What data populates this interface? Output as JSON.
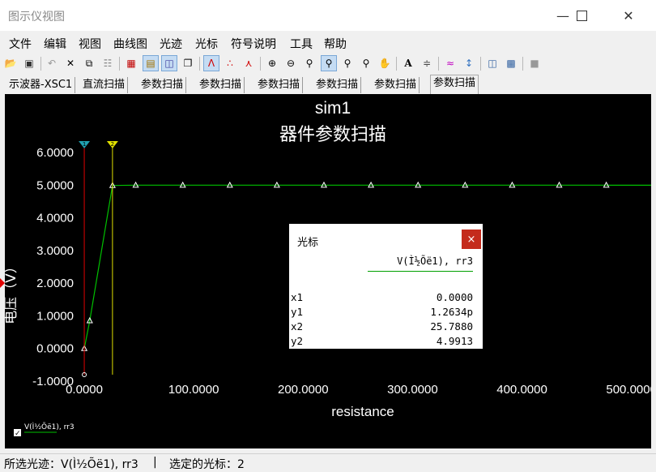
{
  "window": {
    "title": "图示仪视图",
    "minimize_icon": "minimize-icon",
    "maximize_icon": "maximize-icon",
    "close_icon": "close-icon"
  },
  "menu": [
    "文件",
    "编辑",
    "视图",
    "曲线图",
    "光迹",
    "光标",
    "符号说明",
    "工具",
    "帮助"
  ],
  "tabs": [
    "示波器-XSC1",
    "直流扫描",
    "参数扫描",
    "参数扫描",
    "参数扫描",
    "参数扫描",
    "参数扫描",
    "参数扫描"
  ],
  "active_tab_index": 7,
  "graph": {
    "title": "sim1",
    "subtitle": "器件参数扫描",
    "background": "#000000",
    "trace_color": "#00c000",
    "cursor1_color": "#e00000",
    "cursor2_color": "#e0e000",
    "cursor1_label": "1",
    "cursor2_label": "2",
    "legend_label": "V(Ì½Õë1), rr3"
  },
  "chart_data": {
    "type": "line",
    "title": "sim1",
    "subtitle": "器件参数扫描",
    "xlabel": "resistance",
    "ylabel": "电压（V）",
    "xlim": [
      -3,
      518
    ],
    "ylim": [
      -1.05,
      6.25
    ],
    "x_ticks": [
      "0.0000",
      "100.0000",
      "200.0000",
      "300.0000",
      "400.0000",
      "500.0000"
    ],
    "x_tick_values": [
      0,
      100,
      200,
      300,
      400,
      500
    ],
    "y_ticks": [
      "6.0000",
      "5.0000",
      "4.0000",
      "3.0000",
      "2.0000",
      "1.0000",
      "0.0000",
      "-1.0000"
    ],
    "y_tick_values": [
      6,
      5,
      4,
      3,
      2,
      1,
      0,
      -1
    ],
    "series": [
      {
        "name": "V(Ì½Õë1), rr3",
        "x": [
          0,
          5,
          25.788,
          47,
          90,
          133,
          176,
          219,
          262,
          305,
          348,
          391,
          434,
          477
        ],
        "y": [
          0,
          0.85,
          4.9913,
          5.0,
          5.0,
          5.0,
          5.0,
          5.0,
          5.0,
          5.0,
          5.0,
          5.0,
          5.0,
          5.0
        ]
      }
    ],
    "cursors": [
      {
        "label": "1",
        "x": 0
      },
      {
        "label": "2",
        "x": 25.788
      }
    ]
  },
  "cursor_window": {
    "title": "光标",
    "close_label": "×",
    "trace": "V(Ì½Õë1), rr3",
    "rows": [
      {
        "label": "x1",
        "value": "0.0000"
      },
      {
        "label": "y1",
        "value": "1.2634p"
      },
      {
        "label": "x2",
        "value": "25.7880"
      },
      {
        "label": "y2",
        "value": "4.9913"
      }
    ]
  },
  "status": {
    "selected_trace": "所选光迹：V(Ì½Õë1), rr3",
    "divider": "|",
    "selected_cursor": "选定的光标：2"
  },
  "toolbar_icons": [
    "open-icon",
    "save-icon",
    "undo-icon",
    "cut-icon",
    "copy-icon",
    "paste-icon",
    "grid-icon",
    "legend-icon",
    "cursor-toggle-icon",
    "overlay-icon",
    "line-icon",
    "dots-icon",
    "line-dots-icon",
    "zoom-in-icon",
    "zoom-out-icon",
    "zoom-fit-icon",
    "zoom-x-icon",
    "zoom-y-icon",
    "zoom-full-icon",
    "pan-icon",
    "text-icon",
    "properties-icon",
    "overlay-traces-icon",
    "select-icon",
    "export-icon",
    "export-data-icon",
    "stop-icon"
  ]
}
